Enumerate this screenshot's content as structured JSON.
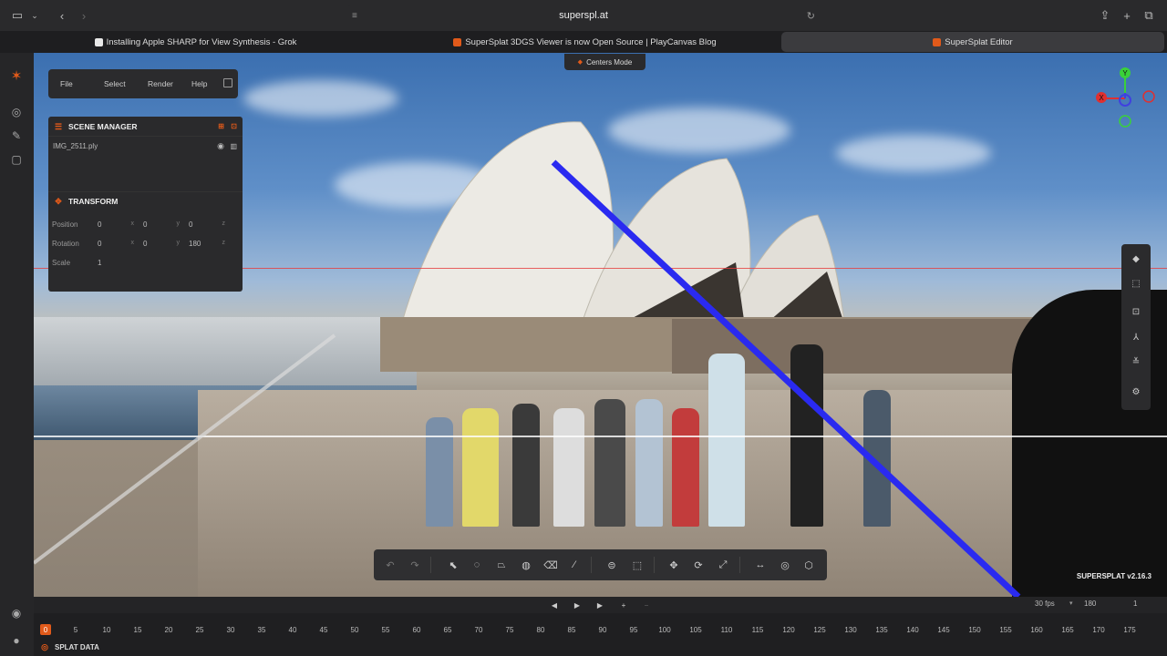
{
  "browser": {
    "url": "superspl.at",
    "tabs": [
      {
        "title": "Installing Apple SHARP for View Synthesis - Grok",
        "active": false,
        "favicon_color": "#e8e8e8"
      },
      {
        "title": "SuperSplat 3DGS Viewer is now Open Source | PlayCanvas Blog",
        "active": false,
        "favicon_color": "#e15a1a"
      },
      {
        "title": "SuperSplat Editor",
        "active": true,
        "favicon_color": "#e15a1a"
      }
    ]
  },
  "menu": {
    "items": [
      "File",
      "Select",
      "Render",
      "Help"
    ]
  },
  "scene_manager": {
    "title": "SCENE MANAGER",
    "file": "IMG_2511.ply"
  },
  "transform": {
    "title": "TRANSFORM",
    "position_label": "Position",
    "rotation_label": "Rotation",
    "scale_label": "Scale",
    "position": [
      "0",
      "0",
      "0"
    ],
    "rotation": [
      "0",
      "0",
      "180"
    ],
    "scale": "1",
    "axes": [
      "x",
      "y",
      "z"
    ]
  },
  "viewport": {
    "mode_label": "Centers Mode",
    "version": "SUPERSPLAT v2.16.3",
    "gizmo_axes": [
      "Y",
      "X"
    ]
  },
  "timeline": {
    "fps": "30 fps",
    "frames": "180",
    "speed": "1",
    "current_frame": "0",
    "ticks": [
      "5",
      "10",
      "15",
      "20",
      "25",
      "30",
      "35",
      "40",
      "45",
      "50",
      "55",
      "60",
      "65",
      "70",
      "75",
      "80",
      "85",
      "90",
      "95",
      "100",
      "105",
      "110",
      "115",
      "120",
      "125",
      "130",
      "135",
      "140",
      "145",
      "150",
      "155",
      "160",
      "165",
      "170",
      "175"
    ]
  },
  "splat_data": {
    "label": "SPLAT DATA"
  },
  "colors": {
    "accent": "#e15a1a",
    "panel": "#2a2a2c",
    "beam": "#2a2af0"
  },
  "icons": {
    "left_rail": [
      "supersplat-logo-icon",
      "compass-icon",
      "brush-icon",
      "folder-icon",
      "discord-icon",
      "account-icon"
    ],
    "right_tools": [
      "diamond-icon",
      "frame-select-icon",
      "focus-icon",
      "axes-icon",
      "sliders-icon",
      "gear-icon"
    ],
    "bottom_tools": [
      "undo-icon",
      "redo-icon",
      "pointer-icon",
      "lasso-icon",
      "polygon-icon",
      "sphere-icon",
      "eraser-icon",
      "eyedropper-icon",
      "box-icon",
      "rect-icon",
      "move-icon",
      "rotate-icon",
      "scale-icon",
      "measure-icon",
      "globe-icon",
      "cube-icon"
    ]
  }
}
